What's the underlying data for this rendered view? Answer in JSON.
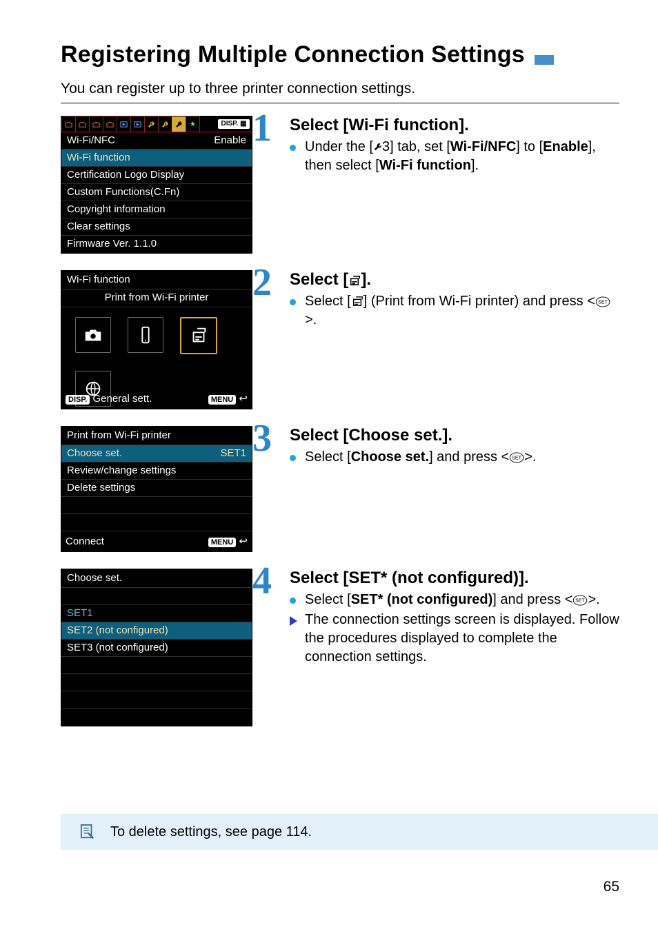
{
  "title": "Registering Multiple Connection Settings",
  "intro": "You can register up to three printer connection settings.",
  "page_number": "65",
  "pane1": {
    "wifi_nfc_label": "Wi-Fi/NFC",
    "wifi_nfc_value": "Enable",
    "items": [
      "Wi-Fi function",
      "Certification Logo Display",
      "Custom Functions(C.Fn)",
      "Copyright information",
      "Clear settings",
      "Firmware Ver. 1.1.0"
    ]
  },
  "pane2": {
    "title": "Wi-Fi function",
    "subtitle": "Print from Wi-Fi printer",
    "foot_left": "DISP.",
    "foot_left_text": "General sett.",
    "foot_right": "MENU"
  },
  "pane3": {
    "title": "Print from Wi-Fi printer",
    "choose_label": "Choose set.",
    "choose_value": "SET1",
    "items": [
      "Review/change settings",
      "Delete settings"
    ],
    "connect": "Connect",
    "foot_right": "MENU"
  },
  "pane4": {
    "title": "Choose set.",
    "set1": "SET1",
    "set2": "SET2 (not configured)",
    "set3": "SET3 (not configured)"
  },
  "step1": {
    "num": "1",
    "heading": "Select [Wi-Fi function].",
    "line_a": "Under the [",
    "line_b": "3] tab, set [",
    "wifinfc": "Wi-Fi/NFC",
    "line_c": "] to [",
    "enable": "Enable",
    "line_d": "], then select [",
    "wifi_func": "Wi-Fi function",
    "line_e": "]."
  },
  "step2": {
    "num": "2",
    "heading_a": "Select [",
    "heading_b": "].",
    "line_a": "Select [",
    "line_b": "] (Print from Wi-Fi printer) and press <",
    "line_c": ">."
  },
  "step3": {
    "num": "3",
    "heading": "Select [Choose set.].",
    "line_a": "Select [",
    "choose": "Choose set.",
    "line_b": "] and press <",
    "line_c": ">."
  },
  "step4": {
    "num": "4",
    "heading": "Select [SET* (not configured)].",
    "line_a": "Select [",
    "setnc": "SET* (not configured)",
    "line_b": "] and press <",
    "line_c": ">.",
    "arrow_text": "The connection settings screen is displayed. Follow the procedures displayed to complete the connection settings."
  },
  "note_text": "To delete settings, see page 114.",
  "glyphs": {
    "disp": "DISP.",
    "menu": "MENU"
  }
}
